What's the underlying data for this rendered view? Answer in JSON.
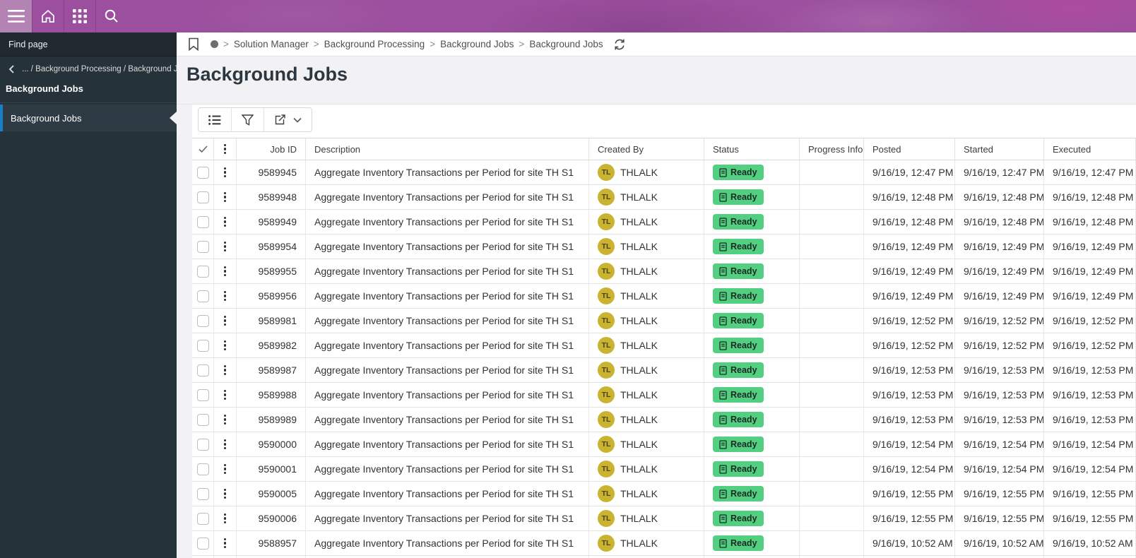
{
  "colors": {
    "purple": "#9b4f9e",
    "purple_light": "#b383b4",
    "sidebar_bg": "#263239",
    "sidebar_selected": "#2e3b44",
    "accent_blue": "#1a7fc4",
    "badge_green": "#53cf82",
    "avatar_yellow": "#c9b331",
    "title_color": "#2d3742"
  },
  "topbar": {
    "icons": [
      "hamburger-menu",
      "home",
      "app-grid",
      "search"
    ]
  },
  "sidebar": {
    "find_page_label": "Find page",
    "back_path": "... / Background Processing / Background Jobs",
    "section_title": "Background Jobs",
    "items": [
      {
        "label": "Background Jobs",
        "selected": true
      }
    ]
  },
  "breadcrumb": {
    "separator": ">",
    "segments": [
      "Solution Manager",
      "Background Processing",
      "Background Jobs",
      "Background Jobs"
    ]
  },
  "page": {
    "title": "Background Jobs"
  },
  "toolbar": {
    "buttons": [
      "list-view",
      "filter",
      "export"
    ]
  },
  "table": {
    "columns": [
      "Job ID",
      "Description",
      "Created By",
      "Status",
      "Progress Info",
      "Posted",
      "Started",
      "Executed"
    ],
    "rows": [
      {
        "job_id": "9589945",
        "description": "Aggregate Inventory Transactions per Period for site TH S1",
        "creator_initials": "TL",
        "creator": "THLALK",
        "status": "Ready",
        "progress": "",
        "posted": "9/16/19, 12:47 PM",
        "started": "9/16/19, 12:47 PM",
        "executed": "9/16/19, 12:47 PM"
      },
      {
        "job_id": "9589948",
        "description": "Aggregate Inventory Transactions per Period for site TH S1",
        "creator_initials": "TL",
        "creator": "THLALK",
        "status": "Ready",
        "progress": "",
        "posted": "9/16/19, 12:48 PM",
        "started": "9/16/19, 12:48 PM",
        "executed": "9/16/19, 12:48 PM"
      },
      {
        "job_id": "9589949",
        "description": "Aggregate Inventory Transactions per Period for site TH S1",
        "creator_initials": "TL",
        "creator": "THLALK",
        "status": "Ready",
        "progress": "",
        "posted": "9/16/19, 12:48 PM",
        "started": "9/16/19, 12:48 PM",
        "executed": "9/16/19, 12:48 PM"
      },
      {
        "job_id": "9589954",
        "description": "Aggregate Inventory Transactions per Period for site TH S1",
        "creator_initials": "TL",
        "creator": "THLALK",
        "status": "Ready",
        "progress": "",
        "posted": "9/16/19, 12:49 PM",
        "started": "9/16/19, 12:49 PM",
        "executed": "9/16/19, 12:49 PM"
      },
      {
        "job_id": "9589955",
        "description": "Aggregate Inventory Transactions per Period for site TH S1",
        "creator_initials": "TL",
        "creator": "THLALK",
        "status": "Ready",
        "progress": "",
        "posted": "9/16/19, 12:49 PM",
        "started": "9/16/19, 12:49 PM",
        "executed": "9/16/19, 12:49 PM"
      },
      {
        "job_id": "9589956",
        "description": "Aggregate Inventory Transactions per Period for site TH S1",
        "creator_initials": "TL",
        "creator": "THLALK",
        "status": "Ready",
        "progress": "",
        "posted": "9/16/19, 12:49 PM",
        "started": "9/16/19, 12:49 PM",
        "executed": "9/16/19, 12:49 PM"
      },
      {
        "job_id": "9589981",
        "description": "Aggregate Inventory Transactions per Period for site TH S1",
        "creator_initials": "TL",
        "creator": "THLALK",
        "status": "Ready",
        "progress": "",
        "posted": "9/16/19, 12:52 PM",
        "started": "9/16/19, 12:52 PM",
        "executed": "9/16/19, 12:52 PM"
      },
      {
        "job_id": "9589982",
        "description": "Aggregate Inventory Transactions per Period for site TH S1",
        "creator_initials": "TL",
        "creator": "THLALK",
        "status": "Ready",
        "progress": "",
        "posted": "9/16/19, 12:52 PM",
        "started": "9/16/19, 12:52 PM",
        "executed": "9/16/19, 12:52 PM"
      },
      {
        "job_id": "9589987",
        "description": "Aggregate Inventory Transactions per Period for site TH S1",
        "creator_initials": "TL",
        "creator": "THLALK",
        "status": "Ready",
        "progress": "",
        "posted": "9/16/19, 12:53 PM",
        "started": "9/16/19, 12:53 PM",
        "executed": "9/16/19, 12:53 PM"
      },
      {
        "job_id": "9589988",
        "description": "Aggregate Inventory Transactions per Period for site TH S1",
        "creator_initials": "TL",
        "creator": "THLALK",
        "status": "Ready",
        "progress": "",
        "posted": "9/16/19, 12:53 PM",
        "started": "9/16/19, 12:53 PM",
        "executed": "9/16/19, 12:53 PM"
      },
      {
        "job_id": "9589989",
        "description": "Aggregate Inventory Transactions per Period for site TH S1",
        "creator_initials": "TL",
        "creator": "THLALK",
        "status": "Ready",
        "progress": "",
        "posted": "9/16/19, 12:53 PM",
        "started": "9/16/19, 12:53 PM",
        "executed": "9/16/19, 12:53 PM"
      },
      {
        "job_id": "9590000",
        "description": "Aggregate Inventory Transactions per Period for site TH S1",
        "creator_initials": "TL",
        "creator": "THLALK",
        "status": "Ready",
        "progress": "",
        "posted": "9/16/19, 12:54 PM",
        "started": "9/16/19, 12:54 PM",
        "executed": "9/16/19, 12:54 PM"
      },
      {
        "job_id": "9590001",
        "description": "Aggregate Inventory Transactions per Period for site TH S1",
        "creator_initials": "TL",
        "creator": "THLALK",
        "status": "Ready",
        "progress": "",
        "posted": "9/16/19, 12:54 PM",
        "started": "9/16/19, 12:54 PM",
        "executed": "9/16/19, 12:54 PM"
      },
      {
        "job_id": "9590005",
        "description": "Aggregate Inventory Transactions per Period for site TH S1",
        "creator_initials": "TL",
        "creator": "THLALK",
        "status": "Ready",
        "progress": "",
        "posted": "9/16/19, 12:55 PM",
        "started": "9/16/19, 12:55 PM",
        "executed": "9/16/19, 12:55 PM"
      },
      {
        "job_id": "9590006",
        "description": "Aggregate Inventory Transactions per Period for site TH S1",
        "creator_initials": "TL",
        "creator": "THLALK",
        "status": "Ready",
        "progress": "",
        "posted": "9/16/19, 12:55 PM",
        "started": "9/16/19, 12:55 PM",
        "executed": "9/16/19, 12:55 PM"
      },
      {
        "job_id": "9588957",
        "description": "Aggregate Inventory Transactions per Period for site TH S1",
        "creator_initials": "TL",
        "creator": "THLALK",
        "status": "Ready",
        "progress": "",
        "posted": "9/16/19, 10:52 AM",
        "started": "9/16/19, 10:52 AM",
        "executed": "9/16/19, 10:52 AM"
      }
    ]
  }
}
